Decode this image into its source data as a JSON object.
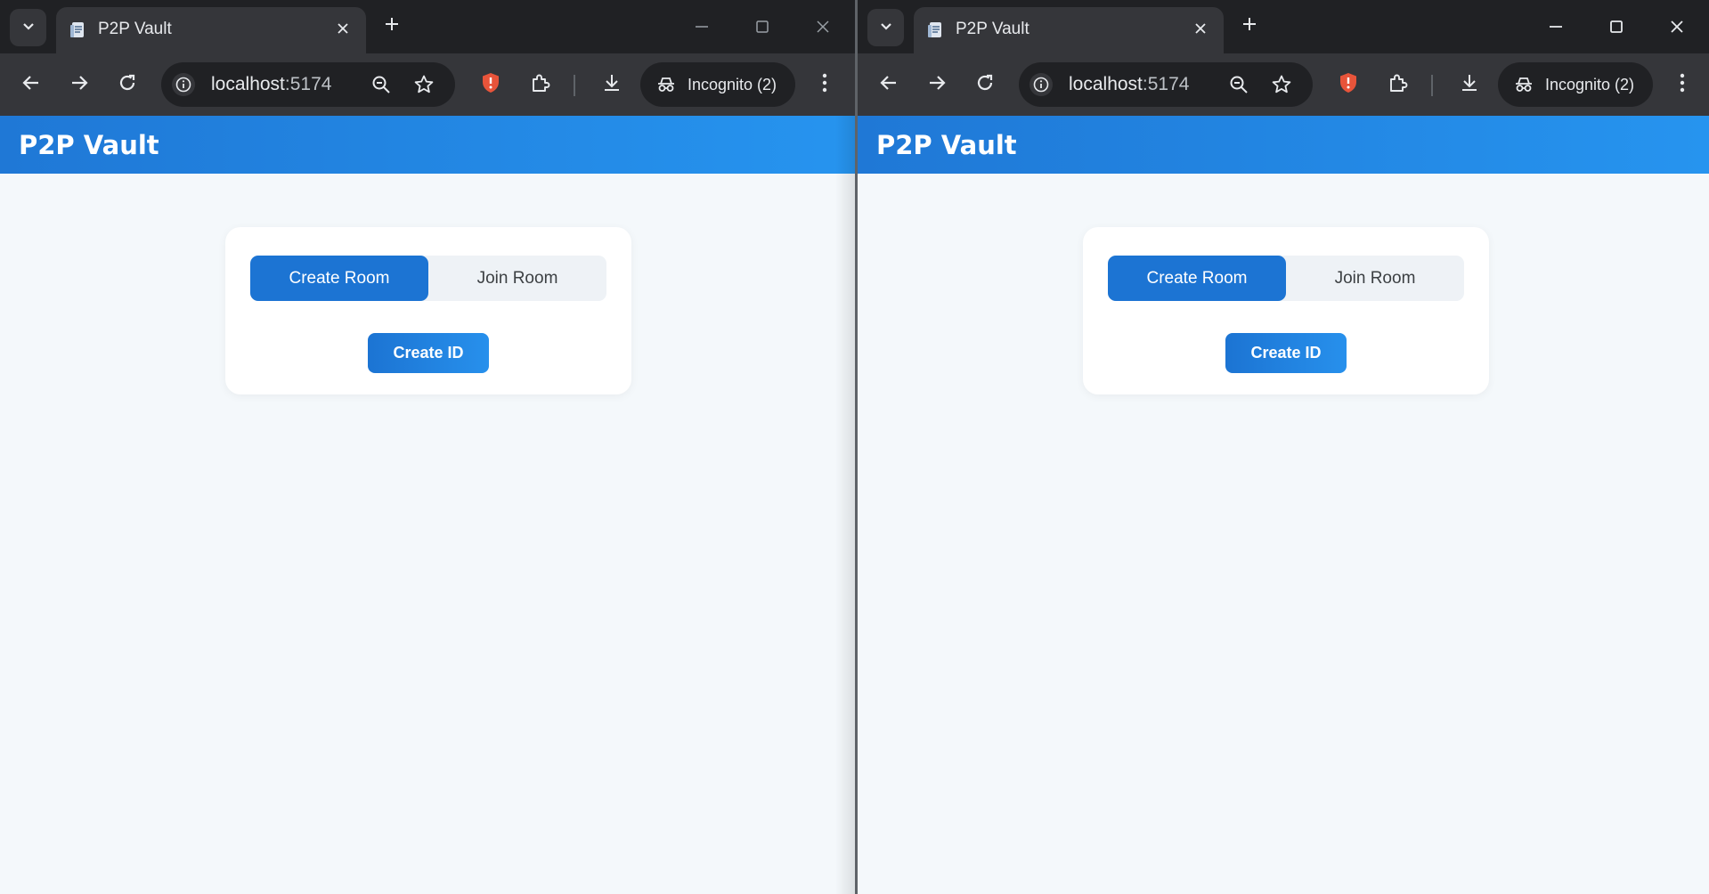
{
  "windows": [
    {
      "tab": {
        "title": "P2P Vault"
      },
      "address": {
        "host": "localhost",
        "port": ":5174"
      },
      "profile": {
        "label": "Incognito (2)"
      },
      "app": {
        "title": "P2P Vault",
        "tabs": [
          {
            "label": "Create Room",
            "active": true
          },
          {
            "label": "Join Room",
            "active": false
          }
        ],
        "primary_button": "Create ID"
      }
    },
    {
      "tab": {
        "title": "P2P Vault"
      },
      "address": {
        "host": "localhost",
        "port": ":5174"
      },
      "profile": {
        "label": "Incognito (2)"
      },
      "app": {
        "title": "P2P Vault",
        "tabs": [
          {
            "label": "Create Room",
            "active": true
          },
          {
            "label": "Join Room",
            "active": false
          }
        ],
        "primary_button": "Create ID"
      }
    }
  ],
  "colors": {
    "app_bar": "#1f78d6",
    "accent": "#1c74d3",
    "page_bg": "#f4f8fb",
    "browser_frame": "#202124",
    "browser_toolbar": "#35363a",
    "shield": "#e8543a"
  },
  "icons": {
    "tab_search": "chevron-down-icon",
    "favicon": "document-icon",
    "tab_close": "close-icon",
    "new_tab": "plus-icon",
    "back": "arrow-left-icon",
    "forward": "arrow-right-icon",
    "reload": "reload-icon",
    "site_info": "info-icon",
    "zoom": "zoom-out-icon",
    "bookmark": "star-icon",
    "extension_shield": "shield-icon",
    "extensions": "puzzle-icon",
    "downloads": "download-icon",
    "incognito": "incognito-icon",
    "menu": "kebab-menu-icon"
  }
}
